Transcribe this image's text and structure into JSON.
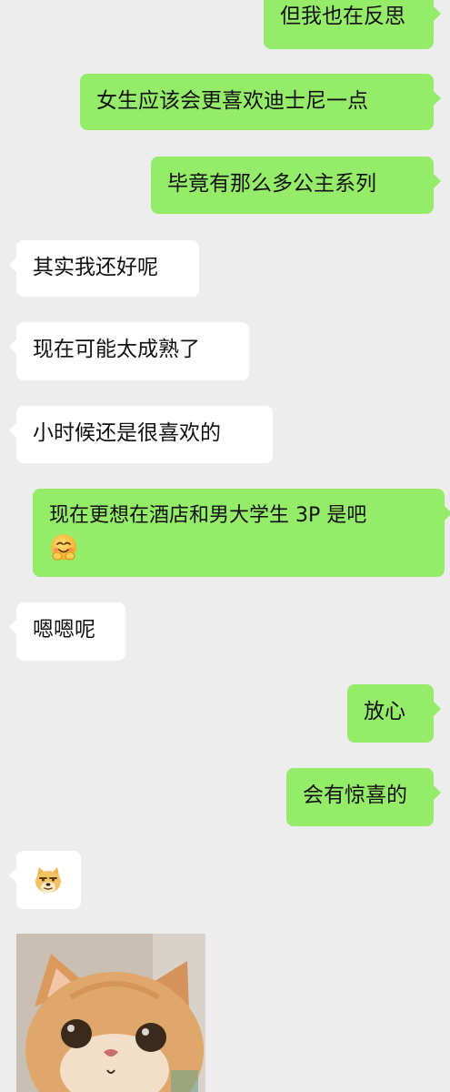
{
  "chat": {
    "messages": [
      {
        "side": "me",
        "text": "但我也在反思"
      },
      {
        "side": "me",
        "text": "女生应该会更喜欢迪士尼一点"
      },
      {
        "side": "me",
        "text": "毕竟有那么多公主系列"
      },
      {
        "side": "other",
        "text": "其实我还好呢"
      },
      {
        "side": "other",
        "text": "现在可能太成熟了"
      },
      {
        "side": "other",
        "text": "小时候还是很喜欢的"
      },
      {
        "side": "me",
        "text": "现在更想在酒店和男大学生 3P 是吧",
        "emoji": "hugging-face-emoji"
      },
      {
        "side": "other",
        "text": "嗯嗯呢"
      },
      {
        "side": "me",
        "text": "放心"
      },
      {
        "side": "me",
        "text": "会有惊喜的"
      },
      {
        "side": "other",
        "emoji": "doge-emoji"
      },
      {
        "side": "other",
        "image": "cat-photo"
      }
    ]
  },
  "colors": {
    "background": "#ededed",
    "my_bubble": "#95ec69",
    "their_bubble": "#ffffff",
    "text": "#111111"
  }
}
